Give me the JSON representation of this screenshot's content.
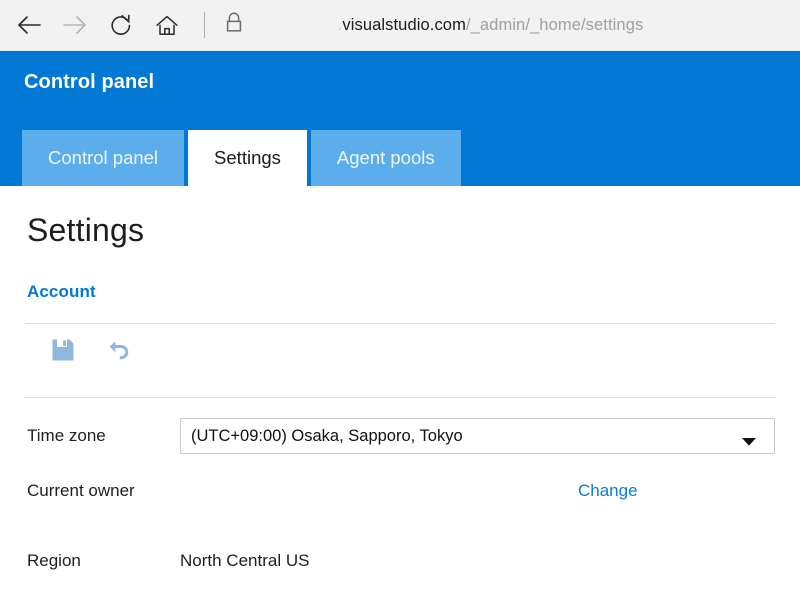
{
  "browser": {
    "nav": {
      "back_icon": "back-arrow-icon",
      "forward_icon": "forward-arrow-icon",
      "refresh_icon": "refresh-icon",
      "home_icon": "home-icon",
      "lock_icon": "padlock-icon"
    },
    "url": {
      "prefix": ".",
      "domain": "visualstudio.com",
      "path": "/_admin/_home/settings",
      "full": "visualstudio.com/_admin/_home/settings"
    }
  },
  "header": {
    "title": "Control panel",
    "accent_color": "#0078d4",
    "tab_inactive_color": "#5badeb",
    "tabs": [
      {
        "label": "Control panel",
        "active": false
      },
      {
        "label": "Settings",
        "active": true
      },
      {
        "label": "Agent pools",
        "active": false
      }
    ]
  },
  "page": {
    "title": "Settings",
    "pivot": "Account",
    "pivot_color": "#0078d4"
  },
  "toolbar": {
    "save_icon": "save-floppy-icon",
    "undo_icon": "undo-arrow-icon",
    "icon_color": "#8fb8dd"
  },
  "form": {
    "timezone": {
      "label": "Time zone",
      "value": "(UTC+09:00) Osaka, Sapporo, Tokyo",
      "arrow_icon": "chevron-down-icon"
    },
    "owner": {
      "label": "Current owner",
      "value": "",
      "change_label": "Change",
      "link_color": "#0a7cd4"
    },
    "region": {
      "label": "Region",
      "value": "North Central US"
    }
  }
}
